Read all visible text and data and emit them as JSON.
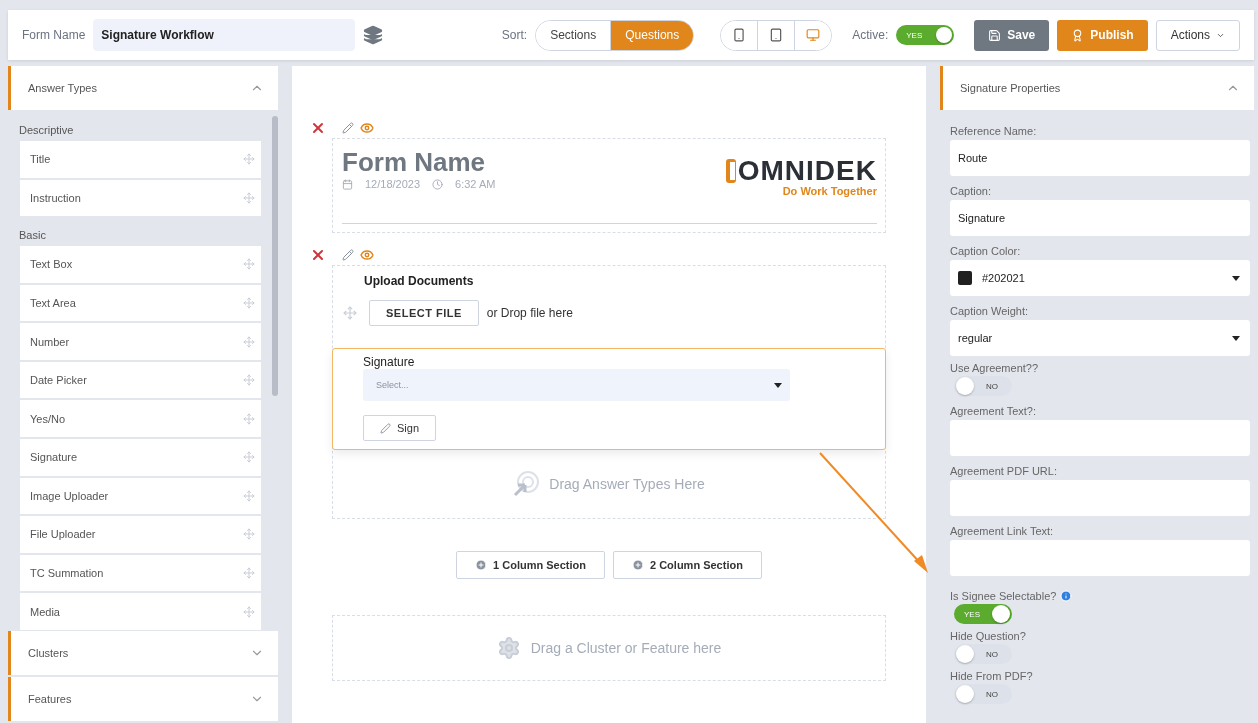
{
  "top_bar": {
    "form_name_label": "Form Name",
    "form_name_value": "Signature Workflow",
    "sort_label": "Sort:",
    "sort_options": [
      {
        "label": "Sections",
        "selected": false
      },
      {
        "label": "Questions",
        "selected": true
      }
    ],
    "device_views": [
      {
        "kind": "phone",
        "selected": false
      },
      {
        "kind": "tablet",
        "selected": false
      },
      {
        "kind": "desktop",
        "selected": true
      }
    ],
    "active_label": "Active:",
    "active_toggle": {
      "on": true,
      "text": "YES"
    },
    "buttons": [
      {
        "kind": "save",
        "label": "Save"
      },
      {
        "kind": "publish",
        "label": "Publish"
      },
      {
        "kind": "actions",
        "label": "Actions"
      }
    ]
  },
  "sidebar": {
    "panels": [
      {
        "title": "Answer Types",
        "expanded": true,
        "groups": [
          {
            "title": "Descriptive",
            "items": [
              "Title",
              "Instruction"
            ]
          },
          {
            "title": "Basic",
            "items": [
              "Text Box",
              "Text Area",
              "Number",
              "Date Picker",
              "Yes/No",
              "Signature",
              "Image Uploader",
              "File Uploader",
              "TC Summation",
              "Media"
            ]
          }
        ]
      },
      {
        "title": "Clusters",
        "expanded": false
      },
      {
        "title": "Features",
        "expanded": false
      }
    ]
  },
  "canvas": {
    "header_block": {
      "title": "Form Name",
      "date": "12/18/2023",
      "time": "6:32 AM",
      "logo_name": "OMNIDEK",
      "logo_tagline": "Do Work Together"
    },
    "question_block": {
      "upload_label": "Upload Documents",
      "select_file_button": "SELECT FILE",
      "drop_text": "or Drop file here",
      "signature_question": {
        "label": "Signature",
        "placeholder": "Select...",
        "sign_button": "Sign",
        "selected": true
      },
      "drop_hint": "Drag Answer Types Here"
    },
    "section_buttons": [
      "1 Column Section",
      "2 Column Section"
    ],
    "cluster_drop_hint": "Drag a Cluster or Feature here"
  },
  "properties": {
    "title": "Signature Properties",
    "expanded": true,
    "fields": [
      {
        "kind": "text",
        "label": "Reference Name:",
        "value": "Route"
      },
      {
        "kind": "text",
        "label": "Caption:",
        "value": "Signature"
      },
      {
        "kind": "color",
        "label": "Caption Color:",
        "value": "#202021",
        "color": "#202021"
      },
      {
        "kind": "select",
        "label": "Caption Weight:",
        "value": "regular"
      },
      {
        "kind": "toggle",
        "label": "Use Agreement??",
        "on": false,
        "text": "NO"
      },
      {
        "kind": "text",
        "label": "Agreement Text?:"
      },
      {
        "kind": "text",
        "label": "Agreement PDF URL:"
      },
      {
        "kind": "text",
        "label": "Agreement Link Text:"
      },
      {
        "kind": "toggle",
        "label": "Is Signee Selectable?",
        "info": true,
        "on": true,
        "text": "YES"
      },
      {
        "kind": "toggle",
        "label": "Hide Question?",
        "on": false,
        "text": "NO"
      },
      {
        "kind": "toggle",
        "label": "Hide From PDF?",
        "on": false,
        "text": "NO"
      }
    ]
  }
}
